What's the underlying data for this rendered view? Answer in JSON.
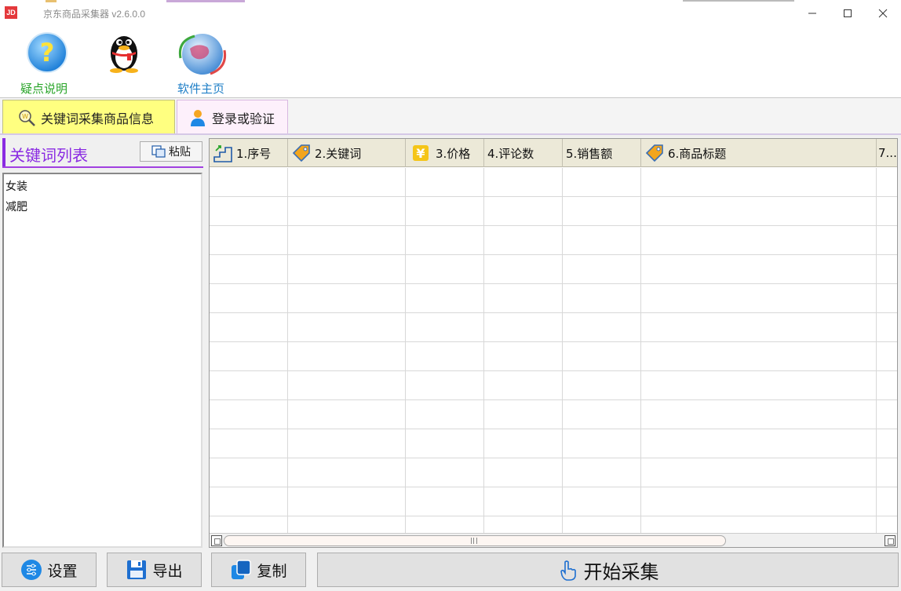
{
  "window": {
    "app_icon_text": "JD",
    "title": "京东商品采集器 v2.6.0.0",
    "controls": {
      "minimize": "—",
      "maximize": "☐",
      "close": "✕"
    }
  },
  "toolbar": {
    "help_label": "疑点说明",
    "qq_label": "",
    "homepage_label": "软件主页"
  },
  "tabs": [
    {
      "label": "关键词采集商品信息"
    },
    {
      "label": "登录或验证"
    }
  ],
  "keywords": {
    "title": "关键词列表",
    "paste_label": "粘贴",
    "items": [
      "女装",
      "减肥"
    ]
  },
  "grid": {
    "columns": [
      {
        "label": "1.序号",
        "icon": "stairs-icon"
      },
      {
        "label": "2.关键词",
        "icon": "tag-icon"
      },
      {
        "label": "3.价格",
        "icon": "yen-icon"
      },
      {
        "label": "4.评论数",
        "icon": ""
      },
      {
        "label": "5.销售额",
        "icon": ""
      },
      {
        "label": "6.商品标题",
        "icon": "tag-icon"
      },
      {
        "label": "7...",
        "icon": ""
      }
    ]
  },
  "buttons": {
    "settings_label": "设置",
    "export_label": "导出",
    "copy_label": "复制",
    "start_label": "开始采集"
  },
  "colors": {
    "accent_purple": "#8a2be2",
    "active_tab": "#ffff80",
    "help_label": "#2aa52a",
    "homepage_label": "#1f7fc7"
  }
}
